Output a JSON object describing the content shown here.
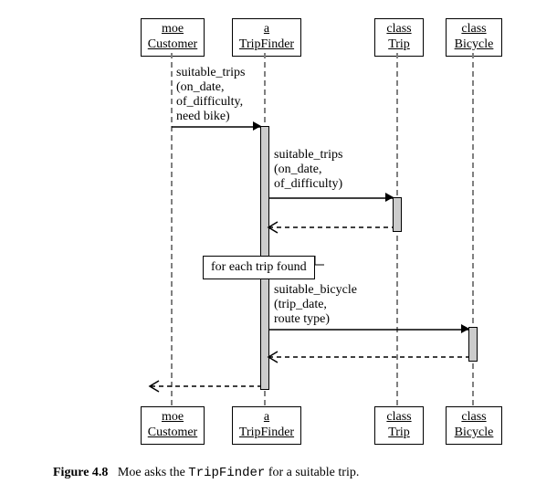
{
  "chart_data": {
    "type": "sequence-diagram",
    "participants": [
      {
        "id": "customer",
        "label_top": "moe",
        "label_bot": "Customer"
      },
      {
        "id": "tripfinder",
        "label_top": "a",
        "label_bot": "TripFinder"
      },
      {
        "id": "trip",
        "label_top": "class",
        "label_bot": "Trip"
      },
      {
        "id": "bicycle",
        "label_top": "class",
        "label_bot": "Bicycle"
      }
    ],
    "messages": [
      {
        "from": "customer",
        "to": "tripfinder",
        "text": "suitable_trips\n(on_date,\nof_difficulty,\nneed bike)",
        "kind": "call"
      },
      {
        "from": "tripfinder",
        "to": "trip",
        "text": "suitable_trips\n(on_date,\nof_difficulty)",
        "kind": "call"
      },
      {
        "from": "trip",
        "to": "tripfinder",
        "text": "",
        "kind": "return"
      },
      {
        "note": "for each trip found"
      },
      {
        "from": "tripfinder",
        "to": "bicycle",
        "text": "suitable_bicycle\n(trip_date,\nroute type)",
        "kind": "call"
      },
      {
        "from": "bicycle",
        "to": "tripfinder",
        "text": "",
        "kind": "return"
      },
      {
        "from": "tripfinder",
        "to": "customer",
        "text": "",
        "kind": "return"
      }
    ]
  },
  "participants": {
    "customer": {
      "line1": "moe",
      "line2": "Customer"
    },
    "tripfinder": {
      "line1": "a",
      "line2": "TripFinder"
    },
    "trip": {
      "line1": "class",
      "line2": "Trip"
    },
    "bicycle": {
      "line1": "class",
      "line2": "Bicycle"
    }
  },
  "messages": {
    "m1": "suitable_trips\n(on_date,\nof_difficulty,\nneed bike)",
    "m2": "suitable_trips\n(on_date,\nof_difficulty)",
    "m3": "suitable_bicycle\n(trip_date,\nroute type)"
  },
  "note": "for each trip found",
  "caption": {
    "figlabel": "Figure 4.8",
    "before": "Moe asks the ",
    "mono": "TripFinder",
    "after": " for a suitable trip."
  }
}
